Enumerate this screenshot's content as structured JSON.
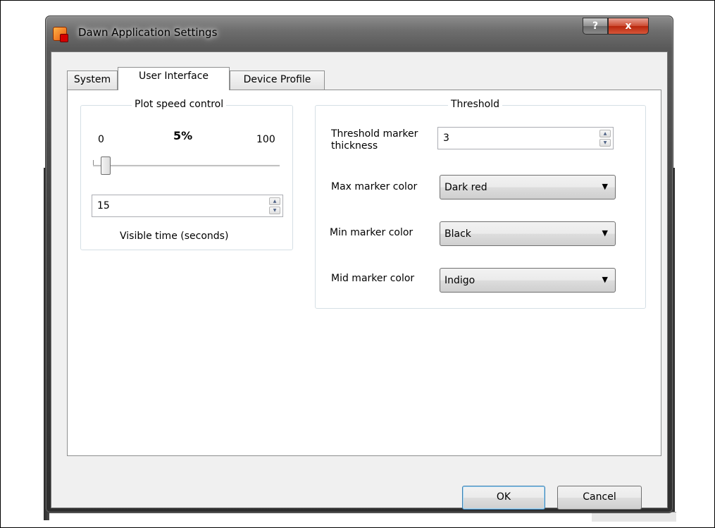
{
  "window": {
    "title": "Dawn Application Settings",
    "help_glyph": "?",
    "close_glyph": "x"
  },
  "tabs": [
    {
      "label": "System",
      "active": false
    },
    {
      "label": "User Interface",
      "active": true
    },
    {
      "label": "Device Profile",
      "active": false
    }
  ],
  "plot_speed": {
    "legend": "Plot speed control",
    "min_label": "0",
    "max_label": "100",
    "percent_label": "5%",
    "slider_value": 5,
    "visible_time_value": "15",
    "visible_time_label": "Visible time (seconds)"
  },
  "threshold": {
    "legend": "Threshold",
    "thickness_label_line1": "Threshold marker",
    "thickness_label_line2": "thickness",
    "thickness_value": "3",
    "max_color_label": "Max marker color",
    "max_color_value": "Dark red",
    "min_color_label": "Min marker color",
    "min_color_value": "Black",
    "mid_color_label": "Mid marker color",
    "mid_color_value": "Indigo"
  },
  "buttons": {
    "ok": "OK",
    "cancel": "Cancel"
  },
  "icons": {
    "app": "app-icon",
    "dropdown": "▼",
    "spin_up": "▲",
    "spin_down": "▼"
  }
}
